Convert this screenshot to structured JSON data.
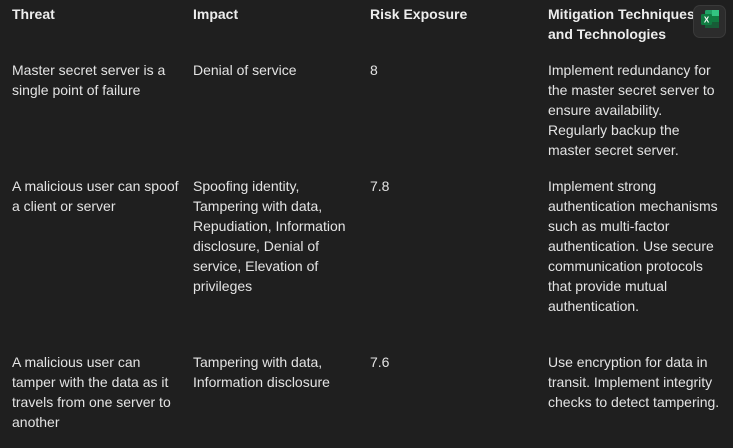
{
  "table": {
    "headers": {
      "threat": "Threat",
      "impact": "Impact",
      "risk": "Risk Exposure",
      "mitigation": "Mitigation Techniques and Technologies"
    },
    "rows": [
      {
        "threat": "Master secret server is a single point of failure",
        "impact": "Denial of service",
        "risk": "8",
        "mitigation": "Implement redundancy for the master secret server to ensure availability. Regularly backup the master secret server."
      },
      {
        "threat": "A malicious user can spoof a client or server",
        "impact": "Spoofing identity, Tampering with data, Repudiation, Information disclosure, Denial of service, Elevation of privileges",
        "risk": "7.8",
        "mitigation": "Implement strong authentication mechanisms such as multi-factor authentication. Use secure communication protocols that provide mutual authentication."
      },
      {
        "threat": "A malicious user can tamper with the data as it travels from one server to another",
        "impact": "Tampering with data, Information disclosure",
        "risk": "7.6",
        "mitigation": "Use encryption for data in transit. Implement integrity checks to detect tampering."
      }
    ]
  },
  "toolbar": {
    "export_icon": "excel-export-icon",
    "export_icon_letter": "X"
  },
  "colors": {
    "background": "#1f1f1f",
    "text": "#e3e3e3",
    "excel_green": "#21a366"
  }
}
